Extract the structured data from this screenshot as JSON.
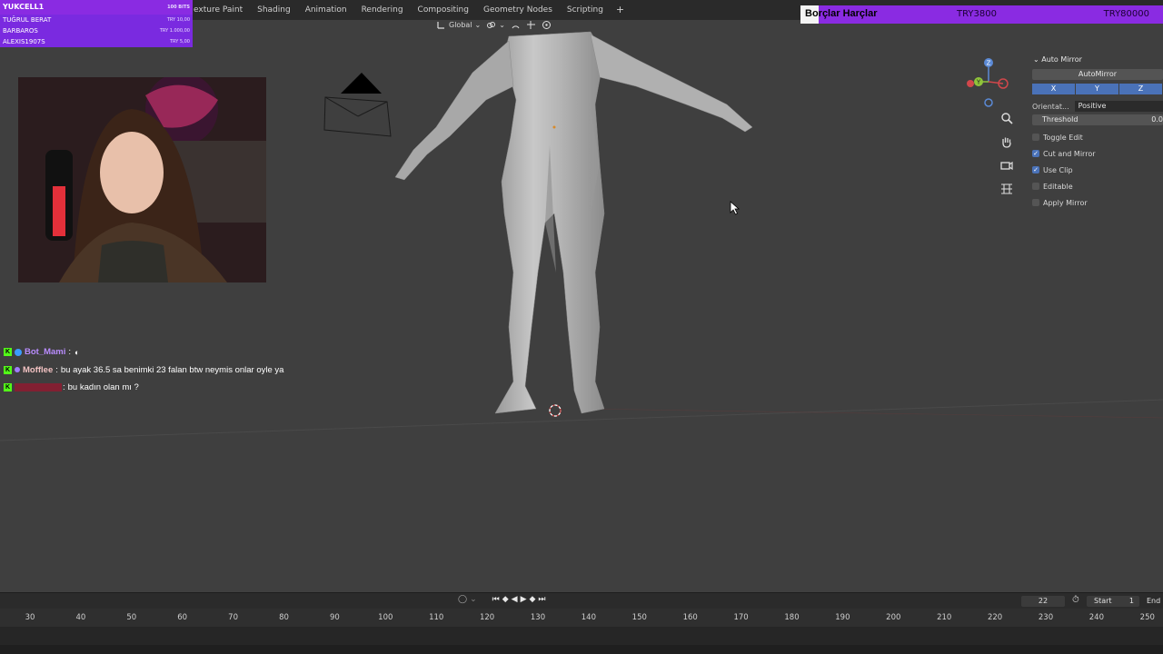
{
  "workspace_tabs": [
    "exture Paint",
    "Shading",
    "Animation",
    "Rendering",
    "Compositing",
    "Geometry Nodes",
    "Scripting"
  ],
  "workspace_add": "+",
  "viewport_header": {
    "orientation": "Global"
  },
  "donations": [
    {
      "name": "YUKCELL1",
      "amount": "100 BITS"
    },
    {
      "name": "TUĞRUL BERAT",
      "amount": "TRY 10,00"
    },
    {
      "name": "BARBAROS",
      "amount": "TRY 1.000,00"
    },
    {
      "name": "ALEXIS1907S",
      "amount": "TRY 5,00"
    }
  ],
  "goal": {
    "label": "Borçlar Harçlar",
    "current": "TRY3800",
    "target": "TRY80000"
  },
  "chat": [
    {
      "user": "Bot_Mami",
      "sep": ":",
      "message": "",
      "color": "#b98cff",
      "badge_color": "#3b9cff"
    },
    {
      "user": "Mofflee",
      "sep": ":",
      "message": "bu ayak 36.5 sa benimki 23 falan btw neymis onlar oyle ya",
      "color": "#f2c2c2",
      "badge_color": "#a07cff"
    },
    {
      "user": "",
      "sep": ":",
      "message": "bu kadın olan mı ?",
      "color": "#a0142e",
      "badge_color": ""
    }
  ],
  "npanel": {
    "title": "Auto Mirror",
    "button": "AutoMirror",
    "axes": [
      "X",
      "Y",
      "Z"
    ],
    "orientation_label": "Orientat...",
    "orientation_value": "Positive",
    "threshold_label": "Threshold",
    "threshold_value": "0.0",
    "checks": [
      {
        "label": "Toggle Edit",
        "checked": false
      },
      {
        "label": "Cut and Mirror",
        "checked": true
      },
      {
        "label": "Use Clip",
        "checked": true
      },
      {
        "label": "Editable",
        "checked": false
      },
      {
        "label": "Apply Mirror",
        "checked": false
      }
    ]
  },
  "gizmo_labels": {
    "z": "Z",
    "y": "Y"
  },
  "timeline": {
    "current_frame": "22",
    "start_label": "Start",
    "start_value": "1",
    "end_label": "End",
    "ruler_ticks": [
      "30",
      "40",
      "50",
      "60",
      "70",
      "80",
      "90",
      "100",
      "110",
      "120",
      "130",
      "140",
      "150",
      "160",
      "170",
      "180",
      "190",
      "200",
      "210",
      "220",
      "230",
      "240",
      "250"
    ]
  },
  "colors": {
    "accent": "#4a72b8",
    "overlay_purple": "#8a2be2",
    "kick_green": "#53fc18"
  }
}
